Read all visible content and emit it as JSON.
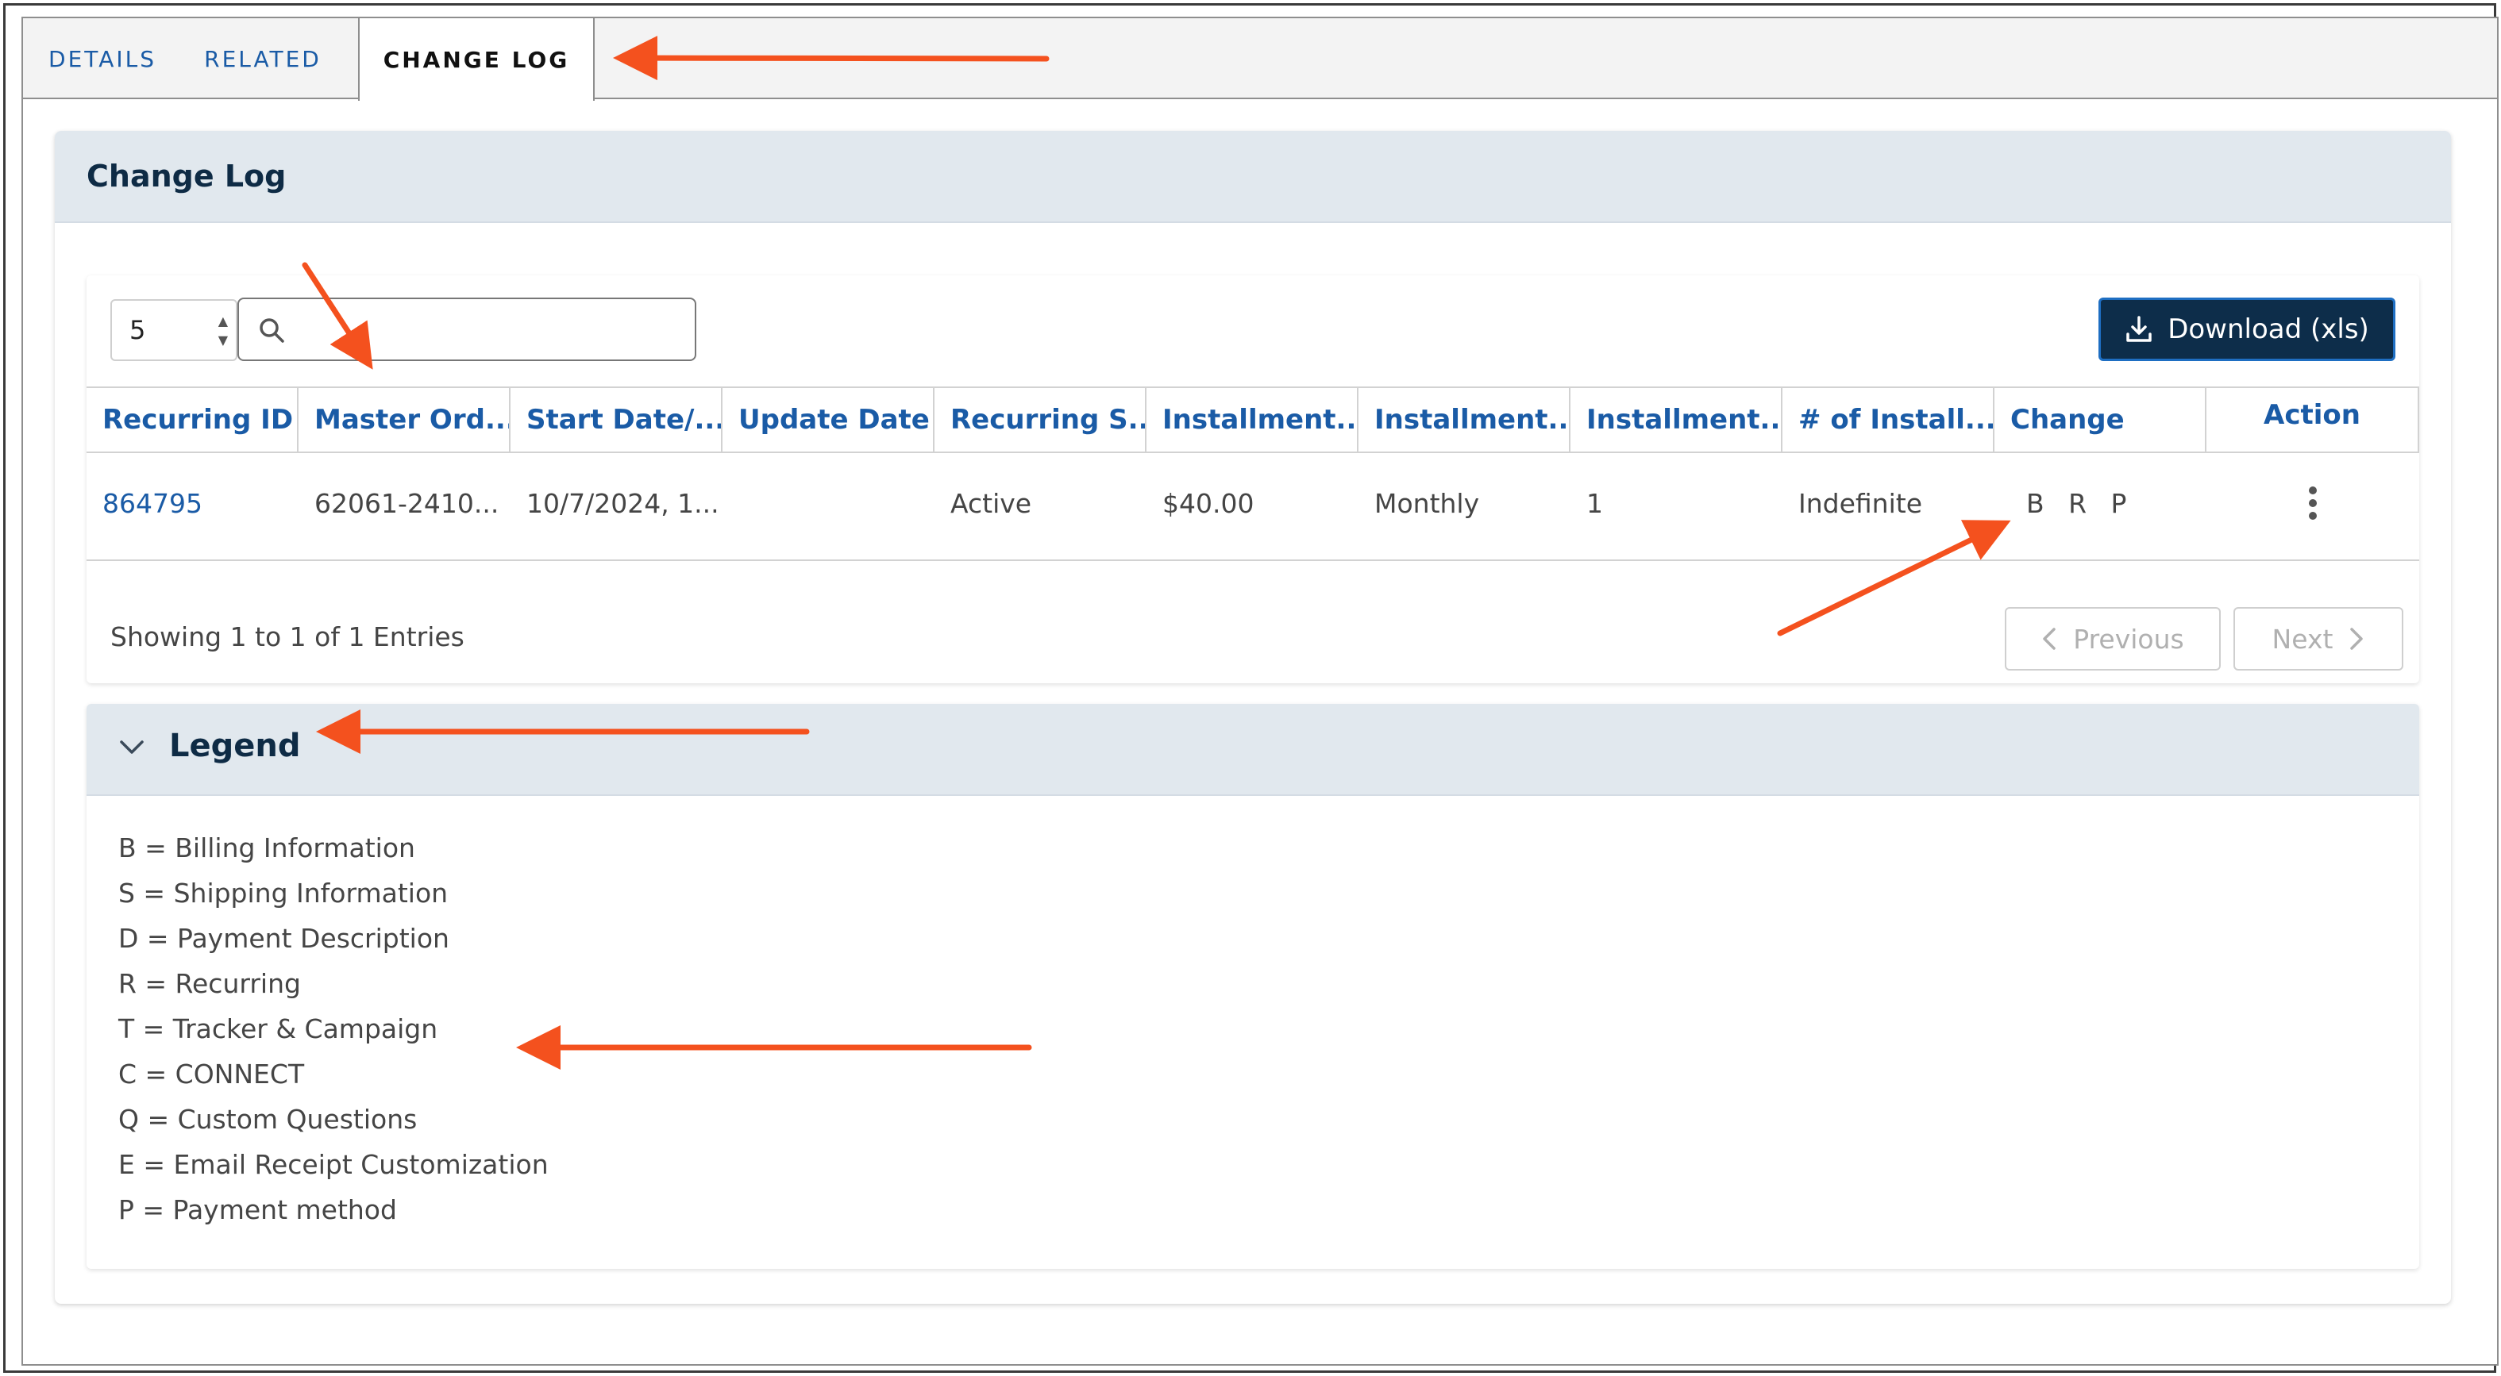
{
  "tabs": [
    {
      "label": "DETAILS"
    },
    {
      "label": "RELATED"
    },
    {
      "label": "CHANGE LOG"
    }
  ],
  "card": {
    "title": "Change Log"
  },
  "controls": {
    "page_size": "5",
    "search_placeholder": "",
    "download_label": "Download (xls)"
  },
  "table": {
    "columns": [
      "Recurring ID",
      "Master Ord...",
      "Start Date/...",
      "Update Date",
      "Recurring S...",
      "Installment...",
      "Installment...",
      "Installment...",
      "# of Install...",
      "Change",
      "Action"
    ],
    "rows": [
      {
        "recurring_id": "864795",
        "master_order": "62061-2410...",
        "start_date": "10/7/2024, 1...",
        "update_date": "",
        "recurring_status": "Active",
        "installment_amount": "$40.00",
        "installment_frequency": "Monthly",
        "installment_count": "1",
        "num_installments": "Indefinite",
        "change": "B R P"
      }
    ]
  },
  "pagination": {
    "showing": "Showing 1 to 1 of 1 Entries",
    "previous": "Previous",
    "next": "Next"
  },
  "legend": {
    "title": "Legend",
    "items": [
      "B = Billing Information",
      "S = Shipping Information",
      "D = Payment Description",
      "R = Recurring",
      "T = Tracker & Campaign",
      "C = CONNECT",
      "Q = Custom Questions",
      "E = Email Receipt Customization",
      "P = Payment method"
    ]
  },
  "colors": {
    "link": "#1a5ba6",
    "header_bg": "#e1e8ee",
    "primary_button": "#0d2d4a",
    "annotation_arrow": "#f4511e"
  }
}
